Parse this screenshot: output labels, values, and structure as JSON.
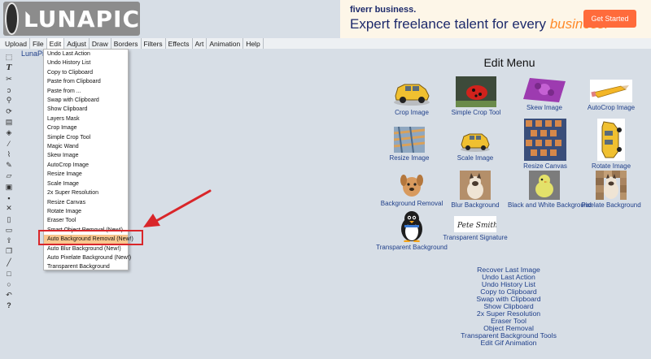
{
  "header": {
    "logo_text": "LUNAPIC",
    "ad": {
      "brand": "fiverr business.",
      "headline_prefix": "Expert freelance talent for every ",
      "headline_accent": "business.",
      "button": "Get Started"
    }
  },
  "menubar": [
    "Upload",
    "File",
    "Edit",
    "Adjust",
    "Draw",
    "Borders",
    "Filters",
    "Effects",
    "Art",
    "Animation",
    "Help"
  ],
  "site_link": "LunaPic",
  "toolbar_icons": [
    "marquee-icon",
    "text-icon",
    "scissors-icon",
    "lasso-icon",
    "zoom-icon",
    "rotate-icon",
    "crop-icon",
    "bucket-icon",
    "eyedropper-icon",
    "brush-icon",
    "pencil-icon",
    "eraser-icon",
    "image-icon",
    "save-icon",
    "close-icon",
    "file-icon",
    "print-icon",
    "share-icon",
    "clone-icon",
    "line-icon",
    "rectangle-icon",
    "circle-icon",
    "undo-icon",
    "help-icon"
  ],
  "dropdown": [
    "Undo Last Action",
    "Undo History List",
    "Copy to Clipboard",
    "Paste from Clipboard",
    "Paste from ...",
    "Swap with Clipboard",
    "Show Clipboard",
    "Layers Mask",
    "Crop Image",
    "Simple Crop Tool",
    "Magic Wand",
    "Skew Image",
    "AutoCrop Image",
    "Resize Image",
    "Scale Image",
    "2x Super Resolution",
    "Resize Canvas",
    "Rotate Image",
    "Eraser Tool",
    "Smart Object Removal (New!)",
    "Auto Background Removal (New!)",
    "Auto Blur Background (New!)",
    "Auto Pixelate Background (New!)",
    "Transparent Background"
  ],
  "edit_menu": {
    "title": "Edit Menu",
    "cards": [
      "Crop Image",
      "Simple Crop Tool",
      "Skew Image",
      "AutoCrop Image",
      "Resize Image",
      "Scale Image",
      "Resize Canvas",
      "Rotate Image",
      "Background Removal",
      "Blur Background",
      "Black and White Background",
      "Pixelate Background",
      "Transparent Background",
      "Transparent Signature"
    ],
    "signature_text": "Pete Smith",
    "links": [
      "Recover Last Image",
      "Undo Last Action",
      "Undo History List",
      "Copy to Clipboard",
      "Swap with Clipboard",
      "Show Clipboard",
      "2x Super Resolution",
      "Eraser Tool",
      "Object Removal",
      "Transparent Background Tools",
      "Edit Gif Animation"
    ]
  },
  "colors": {
    "background": "#d7dee6",
    "link": "#1f3f8a",
    "highlight": "#f9c78f",
    "callout_red": "#d9262a",
    "ad_button": "#ff6b3b"
  }
}
